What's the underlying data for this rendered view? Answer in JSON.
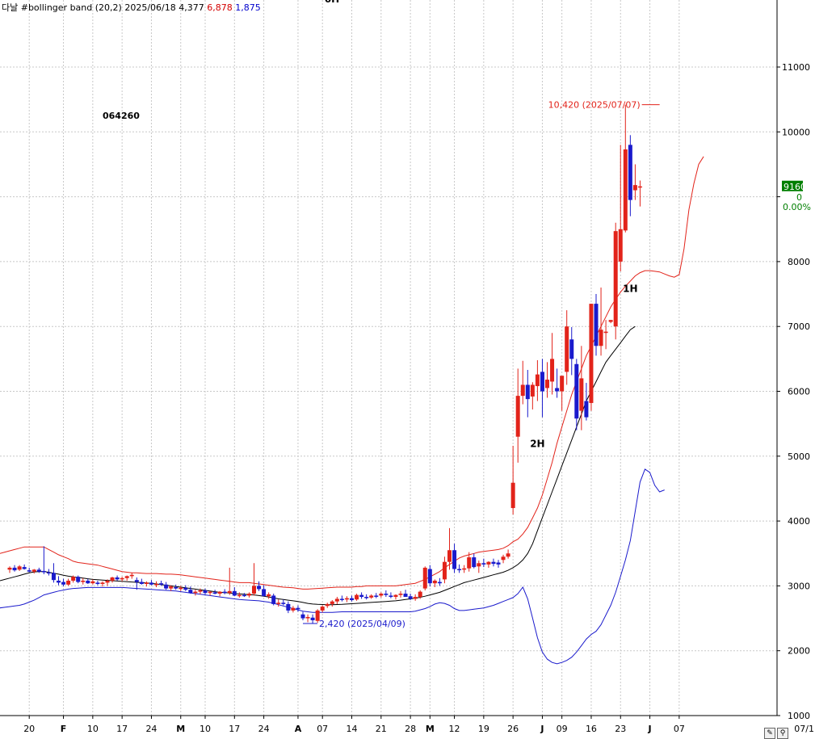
{
  "header": {
    "label": "다날 #bollinger band",
    "params": "(20,2)",
    "date": "2025/06/18",
    "mid": "4,377",
    "upper": "6,878",
    "lower": "1,875",
    "top_cut_text": "6H"
  },
  "stock_code": "064260",
  "toolbar": {
    "edit_icon": "pencil-icon",
    "zoom_icon": "magnifier-icon",
    "end_label": "07/1"
  },
  "colors": {
    "up": "#e2231a",
    "down": "#1a1acc",
    "upper_band": "#e2231a",
    "lower_band": "#1a1acc",
    "mid_band": "#000000",
    "price_box": "#007f00"
  },
  "chart_data": {
    "type": "candlestick",
    "ylim": [
      1000,
      12000
    ],
    "y_ticks": [
      1000,
      2000,
      3000,
      4000,
      5000,
      6000,
      7000,
      8000,
      9000,
      10000,
      11000
    ],
    "y_tick_labels": [
      "1000",
      "2000",
      "3000",
      "4000",
      "5000",
      "6000",
      "7000",
      "8000",
      "",
      "10000",
      "11000"
    ],
    "x_ticks": [
      {
        "i": 4,
        "label": "20"
      },
      {
        "i": 11,
        "label": "F"
      },
      {
        "i": 17,
        "label": "10"
      },
      {
        "i": 23,
        "label": "17"
      },
      {
        "i": 29,
        "label": "24"
      },
      {
        "i": 35,
        "label": "M"
      },
      {
        "i": 40,
        "label": "10"
      },
      {
        "i": 46,
        "label": "17"
      },
      {
        "i": 52,
        "label": "24"
      },
      {
        "i": 59,
        "label": "A"
      },
      {
        "i": 64,
        "label": "07"
      },
      {
        "i": 70,
        "label": "14"
      },
      {
        "i": 76,
        "label": "21"
      },
      {
        "i": 82,
        "label": "28"
      },
      {
        "i": 86,
        "label": "M"
      },
      {
        "i": 91,
        "label": "12"
      },
      {
        "i": 97,
        "label": "19"
      },
      {
        "i": 103,
        "label": "26"
      },
      {
        "i": 109,
        "label": "J"
      },
      {
        "i": 113,
        "label": "09"
      },
      {
        "i": 119,
        "label": "16"
      },
      {
        "i": 125,
        "label": "23"
      },
      {
        "i": 131,
        "label": "J"
      },
      {
        "i": 137,
        "label": "07"
      }
    ],
    "candles": [
      [
        3250,
        3300,
        3200,
        3280
      ],
      [
        3280,
        3320,
        3220,
        3240
      ],
      [
        3250,
        3320,
        3230,
        3300
      ],
      [
        3290,
        3330,
        3250,
        3260
      ],
      [
        3240,
        3280,
        3210,
        3220
      ],
      [
        3220,
        3260,
        3190,
        3250
      ],
      [
        3250,
        3280,
        3200,
        3220
      ],
      [
        3230,
        3610,
        3180,
        3210
      ],
      [
        3210,
        3260,
        3160,
        3200
      ],
      [
        3200,
        3350,
        3050,
        3090
      ],
      [
        3080,
        3150,
        3010,
        3050
      ],
      [
        3060,
        3110,
        2990,
        3020
      ],
      [
        3020,
        3110,
        3000,
        3080
      ],
      [
        3080,
        3160,
        3050,
        3140
      ],
      [
        3140,
        3160,
        3040,
        3060
      ],
      [
        3060,
        3120,
        3020,
        3080
      ],
      [
        3080,
        3110,
        3030,
        3040
      ],
      [
        3040,
        3100,
        3020,
        3070
      ],
      [
        3050,
        3080,
        3010,
        3030
      ],
      [
        3030,
        3070,
        2990,
        3050
      ],
      [
        3050,
        3100,
        3000,
        3080
      ],
      [
        3080,
        3140,
        3050,
        3130
      ],
      [
        3130,
        3160,
        3080,
        3100
      ],
      [
        3100,
        3140,
        3070,
        3120
      ],
      [
        3120,
        3160,
        3080,
        3150
      ],
      [
        3150,
        3200,
        3110,
        3170
      ],
      [
        3090,
        3130,
        2940,
        3060
      ],
      [
        3060,
        3110,
        3020,
        3030
      ],
      [
        3030,
        3070,
        2990,
        3050
      ],
      [
        3050,
        3090,
        3010,
        3020
      ],
      [
        3020,
        3070,
        2980,
        3030
      ],
      [
        3040,
        3080,
        3000,
        3020
      ],
      [
        3020,
        3060,
        2940,
        2960
      ],
      [
        2960,
        3010,
        2920,
        2990
      ],
      [
        2980,
        3020,
        2940,
        2960
      ],
      [
        2960,
        3000,
        2920,
        2970
      ],
      [
        2970,
        3010,
        2920,
        2940
      ],
      [
        2940,
        2990,
        2880,
        2890
      ],
      [
        2890,
        2940,
        2850,
        2910
      ],
      [
        2910,
        2960,
        2870,
        2930
      ],
      [
        2930,
        2960,
        2870,
        2890
      ],
      [
        2890,
        2920,
        2850,
        2910
      ],
      [
        2900,
        2940,
        2870,
        2880
      ],
      [
        2880,
        2920,
        2840,
        2910
      ],
      [
        2910,
        2950,
        2870,
        2890
      ],
      [
        2890,
        3280,
        2860,
        2920
      ],
      [
        2920,
        2980,
        2840,
        2850
      ],
      [
        2850,
        2900,
        2820,
        2860
      ],
      [
        2860,
        2890,
        2830,
        2850
      ],
      [
        2850,
        2900,
        2820,
        2880
      ],
      [
        2880,
        3350,
        2850,
        3000
      ],
      [
        3000,
        3070,
        2920,
        2950
      ],
      [
        2950,
        3010,
        2860,
        2840
      ],
      [
        2840,
        2900,
        2800,
        2870
      ],
      [
        2850,
        2880,
        2700,
        2720
      ],
      [
        2720,
        2790,
        2680,
        2740
      ],
      [
        2740,
        2790,
        2700,
        2720
      ],
      [
        2720,
        2760,
        2580,
        2620
      ],
      [
        2620,
        2690,
        2590,
        2660
      ],
      [
        2660,
        2700,
        2600,
        2640
      ],
      [
        2560,
        2600,
        2470,
        2500
      ],
      [
        2500,
        2560,
        2440,
        2520
      ],
      [
        2510,
        2560,
        2420,
        2470
      ],
      [
        2460,
        2640,
        2430,
        2620
      ],
      [
        2620,
        2700,
        2590,
        2680
      ],
      [
        2690,
        2740,
        2660,
        2720
      ],
      [
        2720,
        2780,
        2680,
        2760
      ],
      [
        2760,
        2830,
        2720,
        2800
      ],
      [
        2800,
        2850,
        2760,
        2790
      ],
      [
        2790,
        2840,
        2750,
        2810
      ],
      [
        2810,
        2850,
        2760,
        2780
      ],
      [
        2790,
        2880,
        2770,
        2860
      ],
      [
        2860,
        2900,
        2800,
        2830
      ],
      [
        2830,
        2870,
        2790,
        2820
      ],
      [
        2820,
        2870,
        2800,
        2850
      ],
      [
        2850,
        2890,
        2810,
        2840
      ],
      [
        2850,
        2900,
        2820,
        2880
      ],
      [
        2880,
        2930,
        2830,
        2860
      ],
      [
        2850,
        2900,
        2810,
        2830
      ],
      [
        2830,
        2870,
        2790,
        2860
      ],
      [
        2860,
        2920,
        2820,
        2880
      ],
      [
        2880,
        2940,
        2840,
        2830
      ],
      [
        2840,
        2880,
        2780,
        2800
      ],
      [
        2800,
        2870,
        2770,
        2830
      ],
      [
        2830,
        2930,
        2800,
        2910
      ],
      [
        2960,
        3300,
        2930,
        3280
      ],
      [
        3260,
        3320,
        2990,
        3040
      ],
      [
        3040,
        3100,
        2980,
        3080
      ],
      [
        3060,
        3120,
        3000,
        3040
      ],
      [
        3100,
        3450,
        3040,
        3370
      ],
      [
        3370,
        3890,
        3250,
        3550
      ],
      [
        3550,
        3650,
        3200,
        3260
      ],
      [
        3260,
        3330,
        3200,
        3250
      ],
      [
        3250,
        3320,
        3200,
        3270
      ],
      [
        3270,
        3520,
        3220,
        3440
      ],
      [
        3440,
        3500,
        3270,
        3290
      ],
      [
        3300,
        3390,
        3200,
        3350
      ],
      [
        3350,
        3420,
        3290,
        3330
      ],
      [
        3330,
        3380,
        3280,
        3370
      ],
      [
        3370,
        3420,
        3300,
        3340
      ],
      [
        3360,
        3400,
        3280,
        3330
      ],
      [
        3400,
        3480,
        3350,
        3450
      ],
      [
        3450,
        3560,
        3420,
        3500
      ],
      [
        4200,
        5160,
        4100,
        4590
      ],
      [
        5300,
        6350,
        4900,
        5930
      ],
      [
        5930,
        6470,
        5800,
        6100
      ],
      [
        6100,
        6330,
        5600,
        5880
      ],
      [
        5920,
        6140,
        5720,
        6100
      ],
      [
        6080,
        6480,
        5850,
        6260
      ],
      [
        6300,
        6500,
        5600,
        6000
      ],
      [
        6050,
        6450,
        5900,
        6180
      ],
      [
        6150,
        6900,
        5950,
        6500
      ],
      [
        6050,
        6350,
        5900,
        6000
      ],
      [
        6000,
        6220,
        5700,
        6240
      ],
      [
        6300,
        7250,
        6100,
        7000
      ],
      [
        6800,
        6990,
        6250,
        6500
      ],
      [
        6420,
        6500,
        5400,
        5580
      ],
      [
        5700,
        6700,
        5400,
        6200
      ],
      [
        5850,
        6130,
        5550,
        5600
      ],
      [
        5820,
        7350,
        5700,
        7350
      ],
      [
        7350,
        7500,
        6550,
        6700
      ],
      [
        6700,
        7600,
        6550,
        6950
      ],
      [
        6900,
        7100,
        6650,
        6920
      ],
      [
        7070,
        7100,
        7050,
        7100
      ],
      [
        7000,
        8600,
        6800,
        8470
      ],
      [
        8000,
        9800,
        7850,
        8500
      ],
      [
        8480,
        10420,
        8450,
        9730
      ],
      [
        9800,
        9950,
        8700,
        8950
      ],
      [
        9100,
        9500,
        8950,
        9180
      ],
      [
        9150,
        9250,
        8850,
        9160
      ]
    ],
    "bollinger": {
      "upper": [
        3500,
        3520,
        3540,
        3560,
        3580,
        3600,
        3600,
        3600,
        3600,
        3600,
        3560,
        3520,
        3480,
        3450,
        3420,
        3380,
        3360,
        3350,
        3340,
        3330,
        3320,
        3300,
        3280,
        3260,
        3240,
        3220,
        3210,
        3200,
        3200,
        3195,
        3190,
        3190,
        3190,
        3185,
        3180,
        3180,
        3175,
        3170,
        3160,
        3150,
        3140,
        3130,
        3120,
        3110,
        3100,
        3090,
        3080,
        3070,
        3060,
        3050,
        3050,
        3050,
        3040,
        3030,
        3020,
        3010,
        3000,
        2990,
        2980,
        2975,
        2970,
        2960,
        2950,
        2950,
        2955,
        2960,
        2965,
        2970,
        2975,
        2980,
        2980,
        2980,
        2980,
        2990,
        2990,
        3000,
        3000,
        3000,
        3000,
        3000,
        3000,
        3000,
        3010,
        3020,
        3030,
        3040,
        3070,
        3100,
        3140,
        3180,
        3220,
        3280,
        3330,
        3380,
        3430,
        3460,
        3480,
        3500,
        3520,
        3530,
        3540,
        3550,
        3560,
        3580,
        3620,
        3680,
        3720,
        3800,
        3900,
        4050,
        4200,
        4400,
        4650,
        4900,
        5200,
        5450,
        5700,
        5950,
        6150,
        6350,
        6550,
        6700,
        6850,
        7000,
        7150,
        7300,
        7420,
        7530,
        7620,
        7700,
        7780,
        7830,
        7860,
        7860,
        7850,
        7840,
        7810,
        7780,
        7760,
        7800,
        8200,
        8800,
        9200,
        9500,
        9620
      ],
      "mid": [
        3080,
        3100,
        3120,
        3140,
        3160,
        3180,
        3200,
        3215,
        3220,
        3220,
        3210,
        3195,
        3180,
        3165,
        3150,
        3140,
        3130,
        3120,
        3110,
        3100,
        3095,
        3090,
        3085,
        3080,
        3075,
        3070,
        3065,
        3060,
        3055,
        3050,
        3045,
        3040,
        3030,
        3020,
        3010,
        3000,
        2990,
        2980,
        2970,
        2960,
        2950,
        2940,
        2930,
        2920,
        2910,
        2900,
        2895,
        2890,
        2880,
        2875,
        2870,
        2865,
        2860,
        2850,
        2840,
        2830,
        2815,
        2800,
        2790,
        2780,
        2770,
        2760,
        2745,
        2730,
        2720,
        2715,
        2712,
        2710,
        2710,
        2712,
        2715,
        2720,
        2725,
        2730,
        2735,
        2740,
        2745,
        2750,
        2755,
        2760,
        2765,
        2770,
        2780,
        2790,
        2800,
        2810,
        2825,
        2840,
        2860,
        2880,
        2900,
        2930,
        2960,
        2990,
        3020,
        3050,
        3070,
        3090,
        3110,
        3130,
        3150,
        3170,
        3190,
        3210,
        3240,
        3280,
        3330,
        3400,
        3500,
        3650,
        3850,
        4050,
        4250,
        4450,
        4650,
        4850,
        5050,
        5250,
        5450,
        5650,
        5850,
        6000,
        6150,
        6300,
        6450,
        6550,
        6650,
        6750,
        6850,
        6950,
        7000
      ],
      "lower": [
        2660,
        2670,
        2680,
        2690,
        2700,
        2720,
        2750,
        2780,
        2820,
        2860,
        2880,
        2900,
        2920,
        2935,
        2950,
        2960,
        2965,
        2970,
        2975,
        2975,
        2975,
        2975,
        2975,
        2975,
        2975,
        2975,
        2970,
        2965,
        2960,
        2955,
        2950,
        2945,
        2940,
        2935,
        2930,
        2925,
        2920,
        2910,
        2900,
        2890,
        2880,
        2870,
        2860,
        2850,
        2840,
        2830,
        2820,
        2810,
        2800,
        2790,
        2785,
        2780,
        2775,
        2770,
        2760,
        2750,
        2730,
        2710,
        2690,
        2670,
        2650,
        2630,
        2610,
        2600,
        2590,
        2590,
        2590,
        2590,
        2590,
        2595,
        2600,
        2600,
        2600,
        2600,
        2600,
        2600,
        2600,
        2600,
        2600,
        2600,
        2600,
        2600,
        2600,
        2600,
        2600,
        2610,
        2630,
        2650,
        2680,
        2720,
        2740,
        2730,
        2700,
        2650,
        2620,
        2620,
        2630,
        2640,
        2650,
        2660,
        2680,
        2700,
        2730,
        2760,
        2790,
        2820,
        2880,
        2980,
        2800,
        2500,
        2200,
        1980,
        1870,
        1820,
        1800,
        1820,
        1850,
        1900,
        1980,
        2080,
        2180,
        2250,
        2300,
        2400,
        2550,
        2700,
        2900,
        3150,
        3400,
        3700,
        4150,
        4600,
        4800,
        4750,
        4550,
        4450,
        4480
      ],
      "mid_start": 10
    },
    "annotations": [
      {
        "i": 133,
        "value": 10420,
        "text": "10,420 (2025/07/07)",
        "color": "#e2231a"
      },
      {
        "i": 60,
        "value": 2420,
        "text": "2,420 (2025/04/09)",
        "color": "#1a1acc"
      }
    ],
    "labels": [
      {
        "i": 108,
        "value": 5140,
        "text": "2H"
      },
      {
        "i": 127,
        "value": 7530,
        "text": "1H"
      }
    ],
    "current_price": {
      "value": 9160,
      "label": "9160",
      "change": "0",
      "pct": "0.00%"
    }
  }
}
